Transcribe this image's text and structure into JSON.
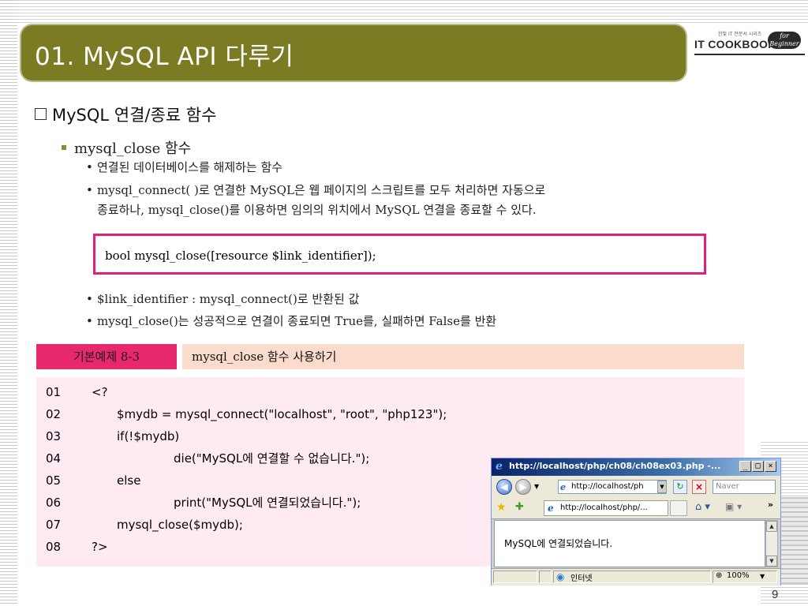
{
  "slide": {
    "title": "01.  MySQL API  다루기",
    "page_number": "9"
  },
  "logo": {
    "main_text": "IT COOKBOOK",
    "small_text": "한빛 IT 전문서 시리즈",
    "badge_text": "for Beginner"
  },
  "section": {
    "heading": "MySQL 연결/종료 함수",
    "subheading": "mysql_close 함수",
    "bullets": [
      "연결된 데이터베이스를 해제하는 함수",
      "mysql_connect( )로 연결한 MySQL은 웹 페이지의 스크립트를 모두 처리하면 자동으로",
      "종료하나, mysql_close()를 이용하면 임의의 위치에서 MySQL 연결을 종료할 수 있다."
    ],
    "syntax": "bool mysql_close([resource $link_identifier]);",
    "bullets2": [
      "$link_identifier : mysql_connect()로 반환된 값",
      "mysql_close()는 성공적으로 연결이 종료되면 True를, 실패하면 False를 반환"
    ]
  },
  "example": {
    "label": "기본예제 8-3",
    "title": "mysql_close 함수 사용하기",
    "lines": [
      {
        "num": "01",
        "code": "<?"
      },
      {
        "num": "02",
        "code": "$mydb = mysql_connect(\"localhost\", \"root\", \"php123\");"
      },
      {
        "num": "03",
        "code": "if(!$mydb)"
      },
      {
        "num": "04",
        "code": "die(\"MySQL에 연결할 수 없습니다.\");"
      },
      {
        "num": "05",
        "code": "else"
      },
      {
        "num": "06",
        "code": "print(\"MySQL에 연결되었습니다.\");"
      },
      {
        "num": "07",
        "code": "mysql_close($mydb);"
      },
      {
        "num": "08",
        "code": "?>"
      }
    ]
  },
  "browser": {
    "title": "http://localhost/php/ch08/ch08ex03.php -...",
    "address": "http://localhost/ph",
    "search_placeholder": "Naver",
    "tab_label": "http://localhost/php/...",
    "content_text": "MySQL에 연결되었습니다.",
    "status_zone": "인터넷",
    "zoom": "100%"
  },
  "colors": {
    "title_bar": "#7b7b24",
    "syntax_border": "#e0207a",
    "example_label_bg": "#e8286e",
    "example_title_bg": "#fbdccc",
    "code_bg": "#fdeaf2"
  }
}
